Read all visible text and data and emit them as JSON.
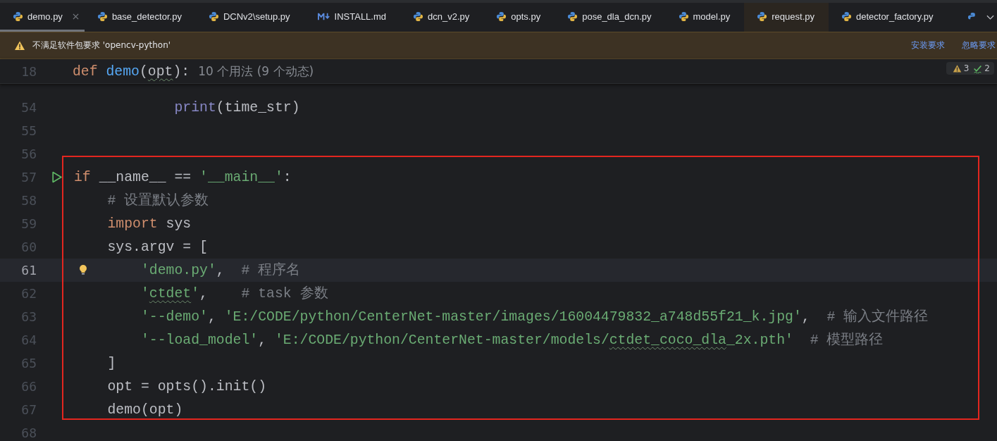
{
  "tabs": [
    {
      "label": "demo.py",
      "kind": "python",
      "selected": true,
      "highlighted": false
    },
    {
      "label": "base_detector.py",
      "kind": "python",
      "selected": false,
      "highlighted": false
    },
    {
      "label": "DCNv2\\setup.py",
      "kind": "python",
      "selected": false,
      "highlighted": false
    },
    {
      "label": "INSTALL.md",
      "kind": "markdown",
      "selected": false,
      "highlighted": false
    },
    {
      "label": "dcn_v2.py",
      "kind": "python",
      "selected": false,
      "highlighted": false
    },
    {
      "label": "opts.py",
      "kind": "python",
      "selected": false,
      "highlighted": false
    },
    {
      "label": "pose_dla_dcn.py",
      "kind": "python",
      "selected": false,
      "highlighted": false
    },
    {
      "label": "model.py",
      "kind": "python",
      "selected": false,
      "highlighted": false
    },
    {
      "label": "request.py",
      "kind": "python",
      "selected": false,
      "highlighted": true
    },
    {
      "label": "detector_factory.py",
      "kind": "python",
      "selected": false,
      "highlighted": false
    }
  ],
  "warning": {
    "message": "不满足软件包要求 'opencv-python'",
    "actions": [
      "安装要求",
      "忽略要求"
    ]
  },
  "inspections": {
    "warnings": "3",
    "ok": "2"
  },
  "sticky_line": {
    "number": "18",
    "tokens": [
      {
        "kind": "keyword",
        "text": "def "
      },
      {
        "kind": "function",
        "text": "demo"
      },
      {
        "kind": "plain",
        "text": "("
      },
      {
        "kind": "plain-typo",
        "text": "opt"
      },
      {
        "kind": "plain",
        "text": "):"
      },
      {
        "kind": "hint-text",
        "text": "10 个用法 (9 个动态)"
      }
    ]
  },
  "lines": [
    {
      "number": "54",
      "kind": "plain",
      "current": false,
      "tokens": [
        {
          "kind": "builtin",
          "text": "            print"
        },
        {
          "kind": "plain",
          "text": "(time_str)"
        }
      ]
    },
    {
      "number": "55",
      "kind": "plain",
      "current": false
    },
    {
      "number": "56",
      "kind": "plain",
      "current": false
    },
    {
      "number": "57",
      "kind": "run",
      "current": false,
      "tokens": [
        {
          "kind": "keyword",
          "text": "if "
        },
        {
          "kind": "plain",
          "text": "__name__ == "
        },
        {
          "kind": "string",
          "text": "'__main__'"
        },
        {
          "kind": "plain",
          "text": ":"
        }
      ]
    },
    {
      "number": "58",
      "kind": "plain",
      "current": false,
      "tokens": [
        {
          "kind": "comment",
          "text": "    # 设置默认参数"
        }
      ]
    },
    {
      "number": "59",
      "kind": "plain",
      "current": false,
      "tokens": [
        {
          "kind": "keyword",
          "text": "    import "
        },
        {
          "kind": "plain",
          "text": "sys"
        }
      ]
    },
    {
      "number": "60",
      "kind": "plain",
      "current": false,
      "tokens": [
        {
          "kind": "plain",
          "text": "    sys.argv = ["
        }
      ]
    },
    {
      "number": "61",
      "kind": "bulb",
      "current": true,
      "tokens": [
        {
          "kind": "string",
          "text": "        'demo.py'"
        },
        {
          "kind": "plain",
          "text": ",  "
        },
        {
          "kind": "comment",
          "text": "# 程序名"
        }
      ]
    },
    {
      "number": "62",
      "kind": "plain",
      "current": false,
      "tokens": [
        {
          "kind": "string",
          "text": "        '"
        },
        {
          "kind": "string-typo",
          "text": "ctdet"
        },
        {
          "kind": "string",
          "text": "'"
        },
        {
          "kind": "plain",
          "text": ",    "
        },
        {
          "kind": "comment",
          "text": "# task 参数"
        }
      ]
    },
    {
      "number": "63",
      "kind": "plain",
      "current": false,
      "tokens": [
        {
          "kind": "string",
          "text": "        '--demo'"
        },
        {
          "kind": "plain",
          "text": ", "
        },
        {
          "kind": "string",
          "text": "'E:/CODE/python/CenterNet-master/images/16004479832_a748d55f21_k.jpg'"
        },
        {
          "kind": "plain",
          "text": ",  "
        },
        {
          "kind": "comment",
          "text": "# 输入文件路径"
        }
      ]
    },
    {
      "number": "64",
      "kind": "plain",
      "current": false,
      "tokens": [
        {
          "kind": "string",
          "text": "        '--load_model'"
        },
        {
          "kind": "plain",
          "text": ", "
        },
        {
          "kind": "string",
          "text": "'E:/CODE/python/CenterNet-master/models/"
        },
        {
          "kind": "string-typo",
          "text": "ctdet_coco_dla"
        },
        {
          "kind": "string",
          "text": "_2x.pth'"
        },
        {
          "kind": "comment",
          "text": "  # 模型路径"
        }
      ]
    },
    {
      "number": "65",
      "kind": "plain",
      "current": false,
      "tokens": [
        {
          "kind": "plain",
          "text": "    ]"
        }
      ]
    },
    {
      "number": "66",
      "kind": "plain",
      "current": false,
      "tokens": [
        {
          "kind": "plain",
          "text": "    opt = opts().init()"
        }
      ]
    },
    {
      "number": "67",
      "kind": "plain",
      "current": false,
      "tokens": [
        {
          "kind": "plain",
          "text": "    demo(opt)"
        }
      ]
    },
    {
      "number": "68",
      "kind": "plain",
      "current": false
    }
  ]
}
